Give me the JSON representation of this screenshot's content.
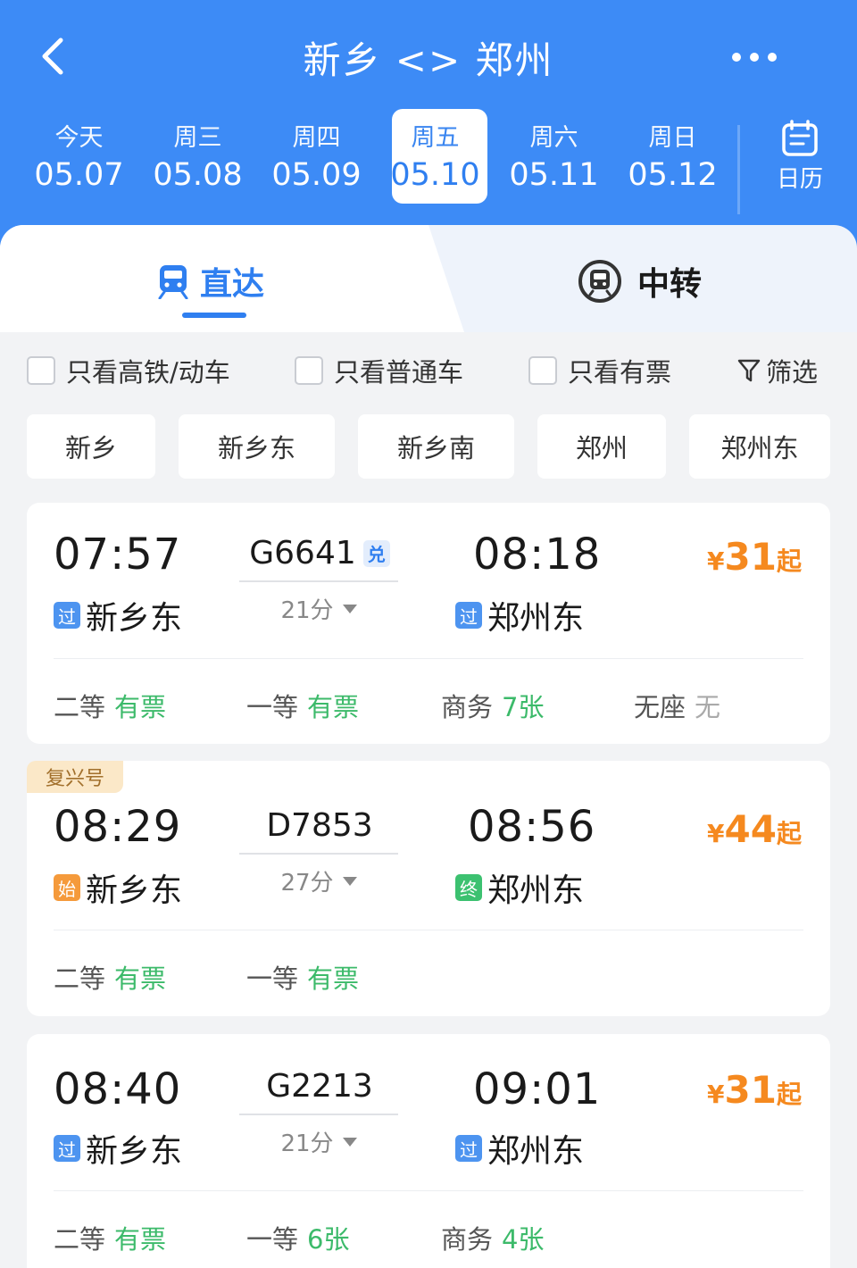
{
  "header": {
    "title": "新乡 <> 郑州",
    "dates": [
      {
        "weekday": "今天",
        "date": "05.07"
      },
      {
        "weekday": "周三",
        "date": "05.08"
      },
      {
        "weekday": "周四",
        "date": "05.09"
      },
      {
        "weekday": "周五",
        "date": "05.10",
        "selected": true
      },
      {
        "weekday": "周六",
        "date": "05.11"
      },
      {
        "weekday": "周日",
        "date": "05.12"
      }
    ],
    "calendar_label": "日历"
  },
  "tabs": {
    "direct": "直达",
    "transfer": "中转"
  },
  "filters": {
    "high_speed": "只看高铁/动车",
    "normal": "只看普通车",
    "available": "只看有票",
    "screen": "筛选"
  },
  "stations": [
    "新乡",
    "新乡东",
    "新乡南",
    "郑州",
    "郑州东"
  ],
  "trains": [
    {
      "dep_time": "07:57",
      "dep_badge": "过",
      "dep_station": "新乡东",
      "train_no": "G6641",
      "exchange_badge": "兑",
      "duration": "21分",
      "arr_time": "08:18",
      "arr_badge": "过",
      "arr_station": "郑州东",
      "price_symbol": "¥",
      "price": "31",
      "price_suffix": "起",
      "seats": [
        {
          "name": "二等",
          "status": "有票"
        },
        {
          "name": "一等",
          "status": "有票"
        },
        {
          "name": "商务",
          "status": "7张"
        },
        {
          "name": "无座",
          "status": "无"
        }
      ]
    },
    {
      "tag": "复兴号",
      "dep_time": "08:29",
      "dep_badge": "始",
      "dep_station": "新乡东",
      "train_no": "D7853",
      "duration": "27分",
      "arr_time": "08:56",
      "arr_badge": "终",
      "arr_station": "郑州东",
      "price_symbol": "¥",
      "price": "44",
      "price_suffix": "起",
      "seats": [
        {
          "name": "二等",
          "status": "有票"
        },
        {
          "name": "一等",
          "status": "有票"
        }
      ]
    },
    {
      "dep_time": "08:40",
      "dep_badge": "过",
      "dep_station": "新乡东",
      "train_no": "G2213",
      "duration": "21分",
      "arr_time": "09:01",
      "arr_badge": "过",
      "arr_station": "郑州东",
      "price_symbol": "¥",
      "price": "31",
      "price_suffix": "起",
      "seats": [
        {
          "name": "二等",
          "status": "有票"
        },
        {
          "name": "一等",
          "status": "6张"
        },
        {
          "name": "商务",
          "status": "4张"
        }
      ]
    }
  ],
  "colors": {
    "header_blue": "#3d8bf6",
    "accent_blue": "#2f7ff0",
    "available_green": "#3cba6a",
    "price_orange": "#f5891f"
  }
}
